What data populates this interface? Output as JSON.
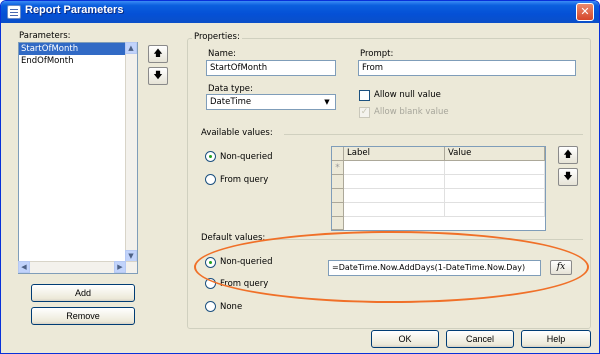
{
  "window": {
    "title": "Report Parameters",
    "close_glyph": "✕"
  },
  "parameters": {
    "label": "Parameters:",
    "items": [
      "StartOfMonth",
      "EndOfMonth"
    ],
    "selected_index": 0,
    "add_label": "Add",
    "remove_label": "Remove",
    "move_up_icon": "arrow-up-icon",
    "move_down_icon": "arrow-down-icon"
  },
  "properties": {
    "legend": "Properties:",
    "name_label": "Name:",
    "name_value": "StartOfMonth",
    "prompt_label": "Prompt:",
    "prompt_value": "From",
    "data_type_label": "Data type:",
    "data_type_value": "DateTime",
    "allow_null_label": "Allow null value",
    "allow_null_checked": false,
    "allow_blank_label": "Allow blank value",
    "allow_blank_checked": true,
    "allow_blank_disabled": true
  },
  "available_values": {
    "legend": "Available values:",
    "options": [
      "Non-queried",
      "From query"
    ],
    "selected": "Non-queried",
    "grid_columns": [
      "Label",
      "Value"
    ],
    "new_row_marker": "*"
  },
  "default_values": {
    "legend": "Default values:",
    "options": [
      "Non-queried",
      "From query",
      "None"
    ],
    "selected": "Non-queried",
    "expression": "=DateTime.Now.AddDays(1-DateTime.Now.Day)",
    "fx_label": "fx"
  },
  "footer": {
    "ok_label": "OK",
    "cancel_label": "Cancel",
    "help_label": "Help"
  },
  "annotation": {
    "highlight_color": "#f07028"
  }
}
